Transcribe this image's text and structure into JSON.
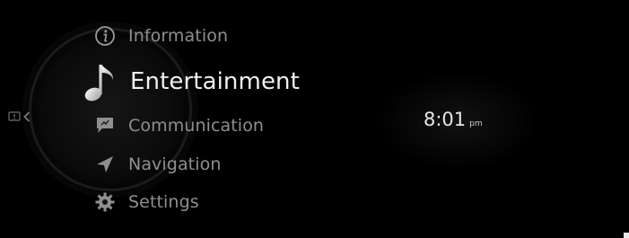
{
  "menu": {
    "items": [
      {
        "label": "Information",
        "icon": "info-icon",
        "selected": false
      },
      {
        "label": "Entertainment",
        "icon": "music-note-icon",
        "selected": true
      },
      {
        "label": "Communication",
        "icon": "chat-bubble-icon",
        "selected": false
      },
      {
        "label": "Navigation",
        "icon": "navigation-arrow-icon",
        "selected": false
      },
      {
        "label": "Settings",
        "icon": "gear-icon",
        "selected": false
      }
    ]
  },
  "side_handle": {
    "icon": "notification-card-icon",
    "arrow_icon": "chevron-left-icon"
  },
  "clock": {
    "time": "8:01",
    "period": "pm"
  },
  "colors": {
    "background": "#000000",
    "selected_text": "#f0f0f0",
    "inactive_text": "#8f8f8f",
    "clock_text": "#e6e6e6"
  }
}
